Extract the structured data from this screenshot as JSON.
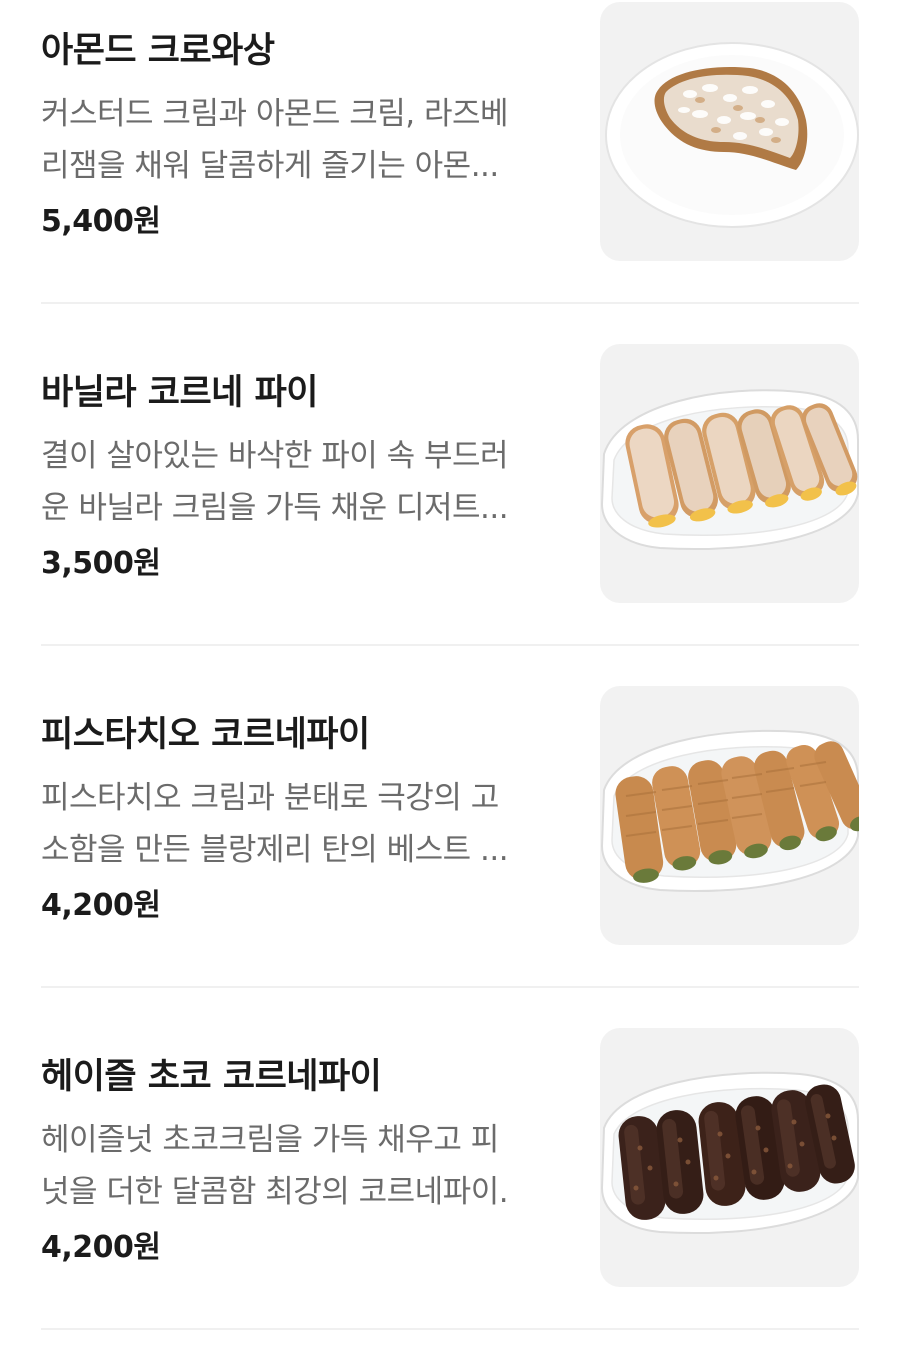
{
  "items": [
    {
      "name": "아몬드 크로와상",
      "desc_line1": "커스터드 크림과 아몬드 크림, 라즈베",
      "desc_line2": "리잼을 채워 달콤하게 즐기는 아몬...",
      "price": "5,400원",
      "image": "almond-croissant-photo"
    },
    {
      "name": "바닐라 코르네 파이",
      "desc_line1": "결이 살아있는 바삭한 파이 속 부드러",
      "desc_line2": "운 바닐라 크림을 가득 채운 디저트...",
      "price": "3,500원",
      "image": "vanilla-cornet-pie-photo"
    },
    {
      "name": "피스타치오 코르네파이",
      "desc_line1": "피스타치오 크림과 분태로 극강의 고",
      "desc_line2": "소함을 만든 블랑제리 탄의 베스트 ...",
      "price": "4,200원",
      "image": "pistachio-cornet-pie-photo"
    },
    {
      "name": "헤이즐 초코 코르네파이",
      "desc_line1": "헤이즐넛 초코크림을 가득 채우고 피",
      "desc_line2": "넛을 더한 달콤함 최강의 코르네파이.",
      "price": "4,200원",
      "image": "hazel-choco-cornet-pie-photo"
    }
  ]
}
